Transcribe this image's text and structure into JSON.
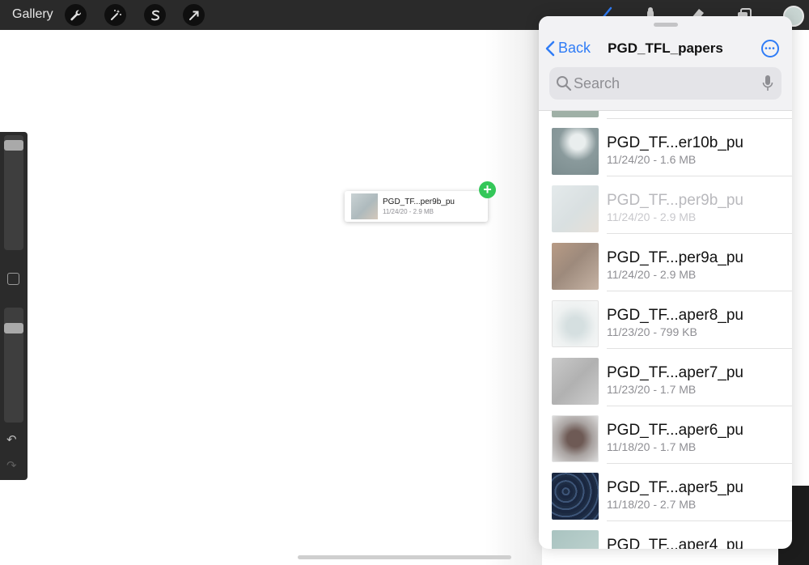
{
  "toolbar": {
    "gallery_label": "Gallery",
    "left_tools": [
      "wrench-icon",
      "magic-wand-icon",
      "selection-s-icon",
      "transform-arrow-icon"
    ],
    "right_tools": [
      "brush-icon",
      "smudge-icon",
      "eraser-icon",
      "layers-icon"
    ],
    "current_color": "#c9d6d3"
  },
  "canvas": {
    "drag_item": {
      "name": "PGD_TF...per9b_pu",
      "meta": "11/24/20 - 2.9 MB",
      "badge": "+"
    }
  },
  "sidebar": {
    "brush_size_level": 0.05,
    "opacity_level": 0.15,
    "undo_icon": "↶",
    "redo_icon": "↷"
  },
  "files_panel": {
    "back_label": "Back",
    "title": "PGD_TFL_papers",
    "search_placeholder": "Search",
    "items": [
      {
        "name": "PGD_TF...er10b_pu",
        "meta": "11/24/20 - 1.6 MB",
        "dimmed": false
      },
      {
        "name": "PGD_TF...per9b_pu",
        "meta": "11/24/20 - 2.9 MB",
        "dimmed": true
      },
      {
        "name": "PGD_TF...per9a_pu",
        "meta": "11/24/20 - 2.9 MB",
        "dimmed": false
      },
      {
        "name": "PGD_TF...aper8_pu",
        "meta": "11/23/20 - 799 KB",
        "dimmed": false
      },
      {
        "name": "PGD_TF...aper7_pu",
        "meta": "11/23/20 - 1.7 MB",
        "dimmed": false
      },
      {
        "name": "PGD_TF...aper6_pu",
        "meta": "11/18/20 - 1.7 MB",
        "dimmed": false
      },
      {
        "name": "PGD_TF...aper5_pu",
        "meta": "11/18/20 - 2.7 MB",
        "dimmed": false
      },
      {
        "name": "PGD_TF...aper4_pu",
        "meta": "",
        "dimmed": false
      }
    ]
  },
  "colors": {
    "accent": "#2f7cf6",
    "add_badge": "#34c759",
    "toolbar_bg": "#2a2a2a"
  }
}
